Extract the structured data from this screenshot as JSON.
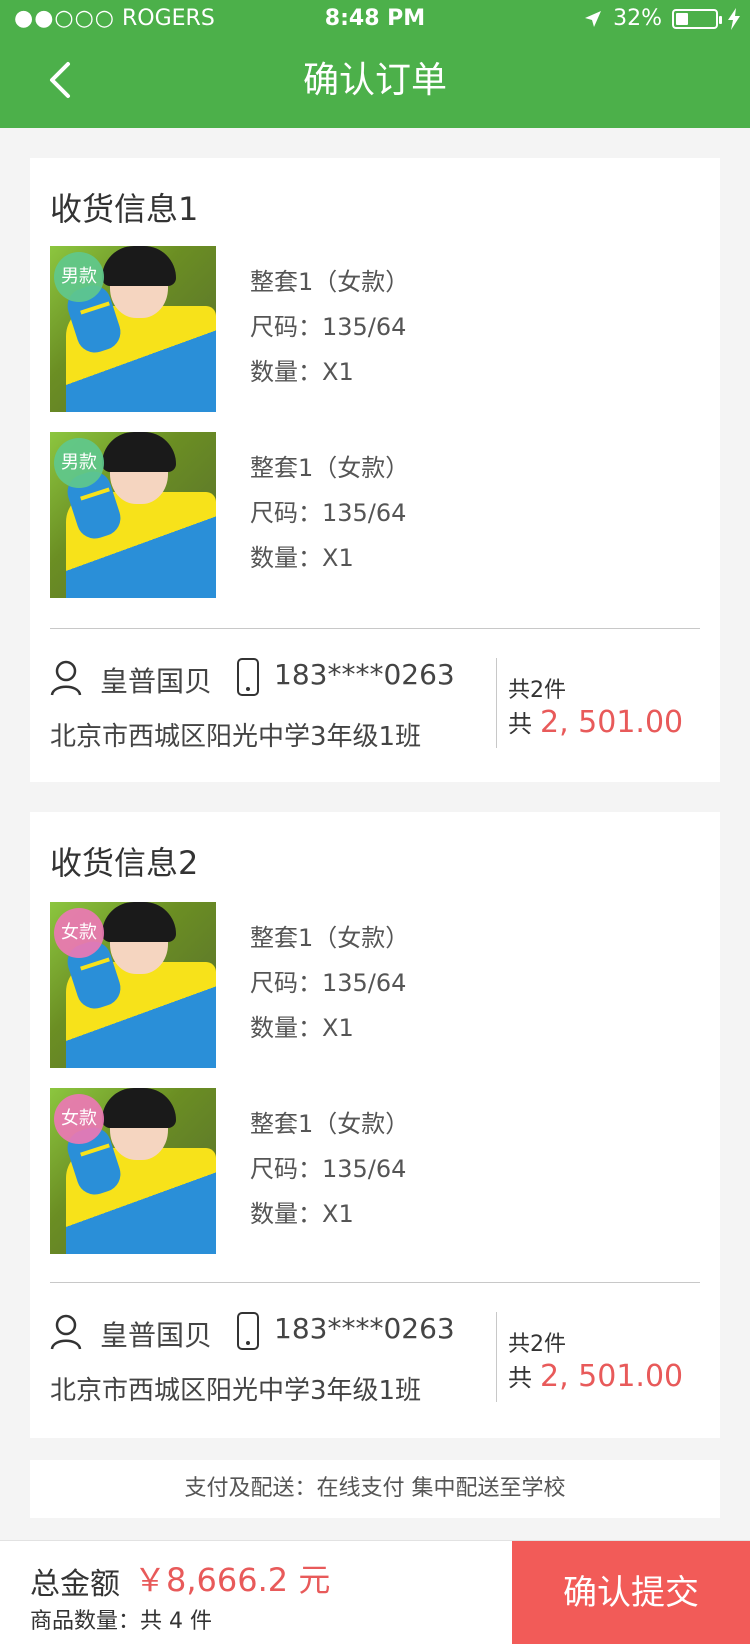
{
  "status_bar": {
    "signal": "●●○○○",
    "carrier": "ROGERS",
    "time": "8:48 PM",
    "battery": "32%"
  },
  "header": {
    "title": "确认订单"
  },
  "orders": [
    {
      "title": "收货信息1",
      "items": [
        {
          "badge": "男款",
          "name": "整套1（女款）",
          "size": "尺码：135/64",
          "qty": "数量：X1"
        },
        {
          "badge": "男款",
          "name": "整套1（女款）",
          "size": "尺码：135/64",
          "qty": "数量：X1"
        }
      ],
      "contact_name": "皇普国贝",
      "phone": "183****0263",
      "address": "北京市西城区阳光中学3年级1班",
      "count": "共2件",
      "total_prefix": "共",
      "total_amount": "2, 501.00"
    },
    {
      "title": "收货信息2",
      "items": [
        {
          "badge": "女款",
          "name": "整套1（女款）",
          "size": "尺码：135/64",
          "qty": "数量：X1"
        },
        {
          "badge": "女款",
          "name": "整套1（女款）",
          "size": "尺码：135/64",
          "qty": "数量：X1"
        }
      ],
      "contact_name": "皇普国贝",
      "phone": "183****0263",
      "address": "北京市西城区阳光中学3年级1班",
      "count": "共2件",
      "total_prefix": "共",
      "total_amount": "2, 501.00"
    }
  ],
  "delivery": {
    "text": "支付及配送：在线支付 集中配送至学校"
  },
  "footer": {
    "total_label": "总金额",
    "total_amount": "￥8,666.2 元",
    "qty_text": "商品数量：共 4 件",
    "submit_label": "确认提交"
  },
  "colors": {
    "brand_green": "#4cb04a",
    "price_red": "#e85a5a",
    "submit_red": "#f25b58"
  }
}
